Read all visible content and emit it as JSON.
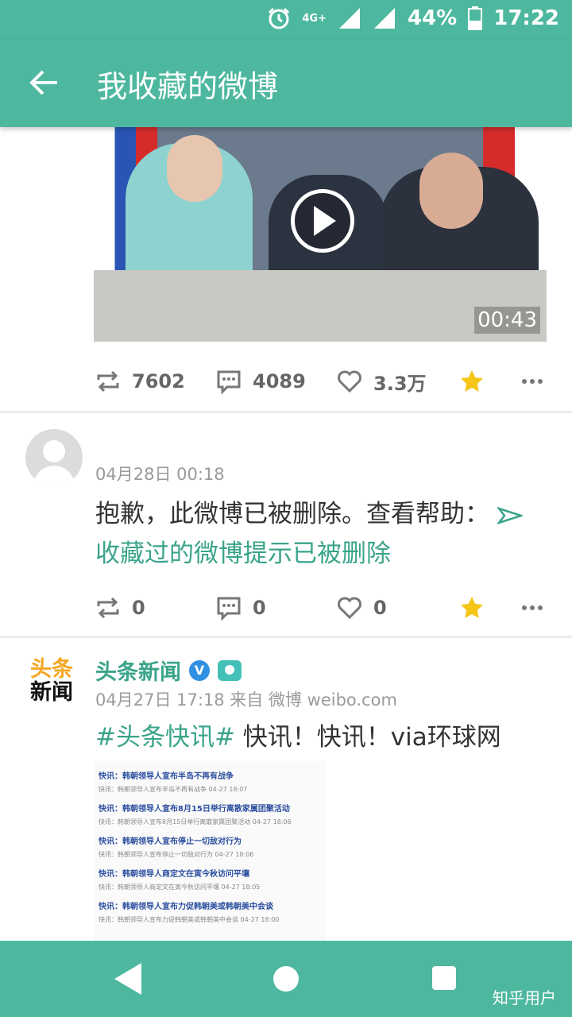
{
  "status_bar": {
    "network": "4G+",
    "battery": "44%",
    "time": "17:22"
  },
  "app_bar": {
    "title": "我收藏的微博"
  },
  "post1": {
    "video_duration": "00:43",
    "reposts": "7602",
    "comments": "4089",
    "likes": "3.3万",
    "favorited": true
  },
  "post2": {
    "timestamp": "04月28日 00:18",
    "text": "抱歉，此微博已被删除。查看帮助：",
    "help_icon": "arrow-icon",
    "link_text": "收藏过的微博提示已被删除",
    "reposts": "0",
    "comments": "0",
    "likes": "0",
    "favorited": true
  },
  "post3": {
    "logo_line1": "头条",
    "logo_line2": "新闻",
    "username": "头条新闻",
    "verified_badge": "V",
    "meta": "04月27日 17:18 来自 微博 weibo.com",
    "hashtag": "#头条快讯#",
    "text": " 快讯！快讯！via环球网",
    "image_items": [
      {
        "headline": "快讯：韩朝领导人宣布半岛不再有战争",
        "sub": "快讯：韩朝领导人宣布半岛不再有战争  04-27 18:07"
      },
      {
        "headline": "快讯：韩朝领导人宣布8月15日举行离散家属团聚活动",
        "sub": "快讯：韩朝领导人宣布8月15日举行离散家属团聚活动  04-27 18:06"
      },
      {
        "headline": "快讯：韩朝领导人宣布停止一切敌对行为",
        "sub": "快讯：韩朝领导人宣布停止一切敌对行为  04-27 18:06"
      },
      {
        "headline": "快讯：韩朝领导人商定文在寅今秋访问平壤",
        "sub": "快讯：韩朝领导人商定文在寅今秋访问平壤  04-27 18:05"
      },
      {
        "headline": "快讯：韩朝领导人宣布力促韩朝美或韩朝美中会谈",
        "sub": "快讯：韩朝领导人宣布力促韩朝美或韩朝美中会谈  04-27 18:00"
      }
    ]
  },
  "nav_bar": {
    "watermark": "知乎用户"
  },
  "colors": {
    "primary": "#4DB89F",
    "link": "#3aa48a",
    "star": "#f5c518"
  }
}
